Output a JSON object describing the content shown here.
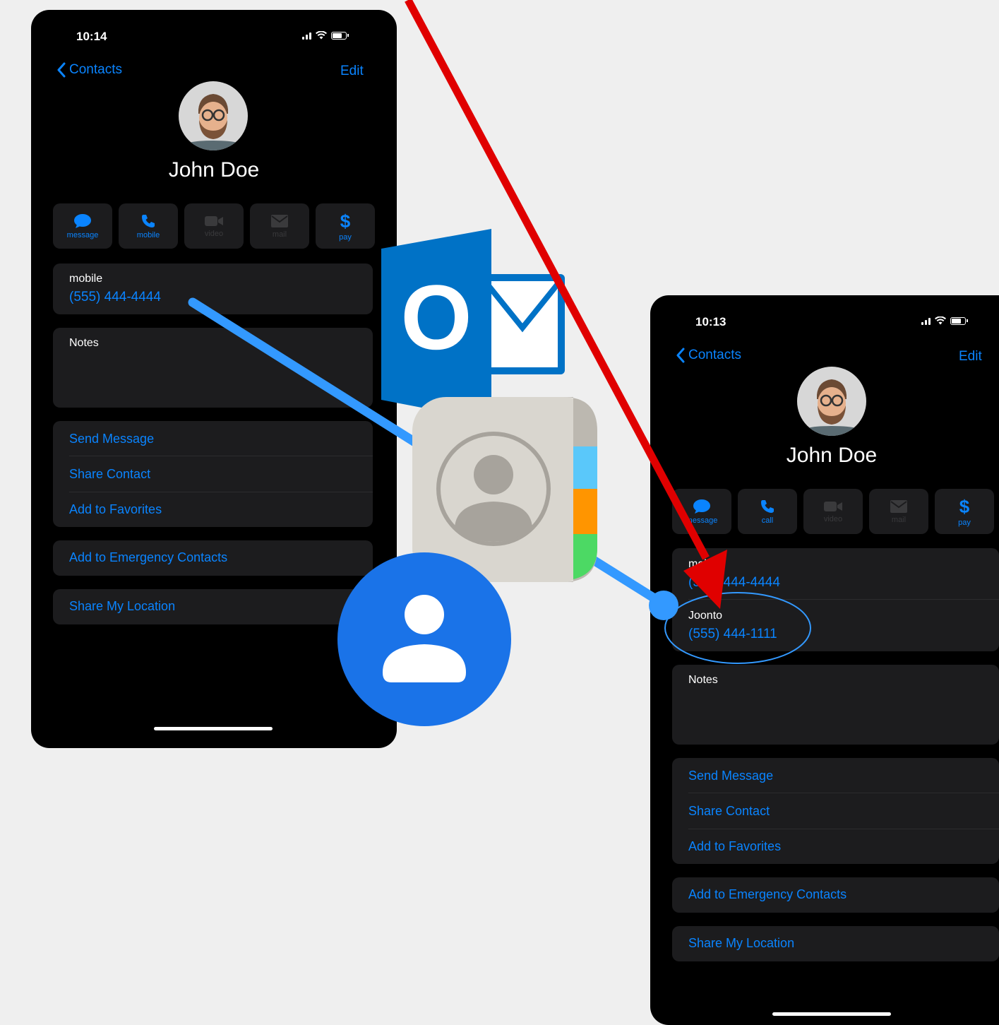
{
  "left_phone": {
    "time": "10:14",
    "back_label": "Contacts",
    "edit_label": "Edit",
    "name": "John Doe",
    "actions": [
      {
        "label": "message",
        "icon": "message-bubble-icon",
        "enabled": true
      },
      {
        "label": "mobile",
        "icon": "phone-icon",
        "enabled": true
      },
      {
        "label": "video",
        "icon": "video-camera-icon",
        "enabled": false
      },
      {
        "label": "mail",
        "icon": "envelope-icon",
        "enabled": false
      },
      {
        "label": "pay",
        "icon": "dollar-icon",
        "enabled": true
      }
    ],
    "phone_field": {
      "label": "mobile",
      "value": "(555) 444-4444"
    },
    "notes_label": "Notes",
    "links": [
      "Send Message",
      "Share Contact",
      "Add to Favorites"
    ],
    "emergency": "Add to Emergency Contacts",
    "location": "Share My Location"
  },
  "right_phone": {
    "time": "10:13",
    "back_label": "Contacts",
    "edit_label": "Edit",
    "name": "John Doe",
    "actions": [
      {
        "label": "message",
        "icon": "message-bubble-icon",
        "enabled": true
      },
      {
        "label": "call",
        "icon": "phone-icon",
        "enabled": true
      },
      {
        "label": "video",
        "icon": "video-camera-icon",
        "enabled": false
      },
      {
        "label": "mail",
        "icon": "envelope-icon",
        "enabled": false
      },
      {
        "label": "pay",
        "icon": "dollar-icon",
        "enabled": true
      }
    ],
    "phone_fields": [
      {
        "label": "mobile",
        "value": "(555) 444-4444"
      },
      {
        "label": "Joonto",
        "value": "(555) 444-1111"
      }
    ],
    "notes_label": "Notes",
    "links": [
      "Send Message",
      "Share Contact",
      "Add to Favorites"
    ],
    "emergency": "Add to Emergency Contacts",
    "location": "Share My Location"
  },
  "overlays": {
    "outlook_letter": "O",
    "app_icons": [
      "outlook-icon",
      "ios-contacts-icon",
      "google-contacts-icon"
    ],
    "colors": {
      "accent": "#0a84ff",
      "arrow": "#e00000",
      "connector": "#3399ff",
      "outlook": "#0072c6",
      "google": "#1a73e8"
    }
  }
}
